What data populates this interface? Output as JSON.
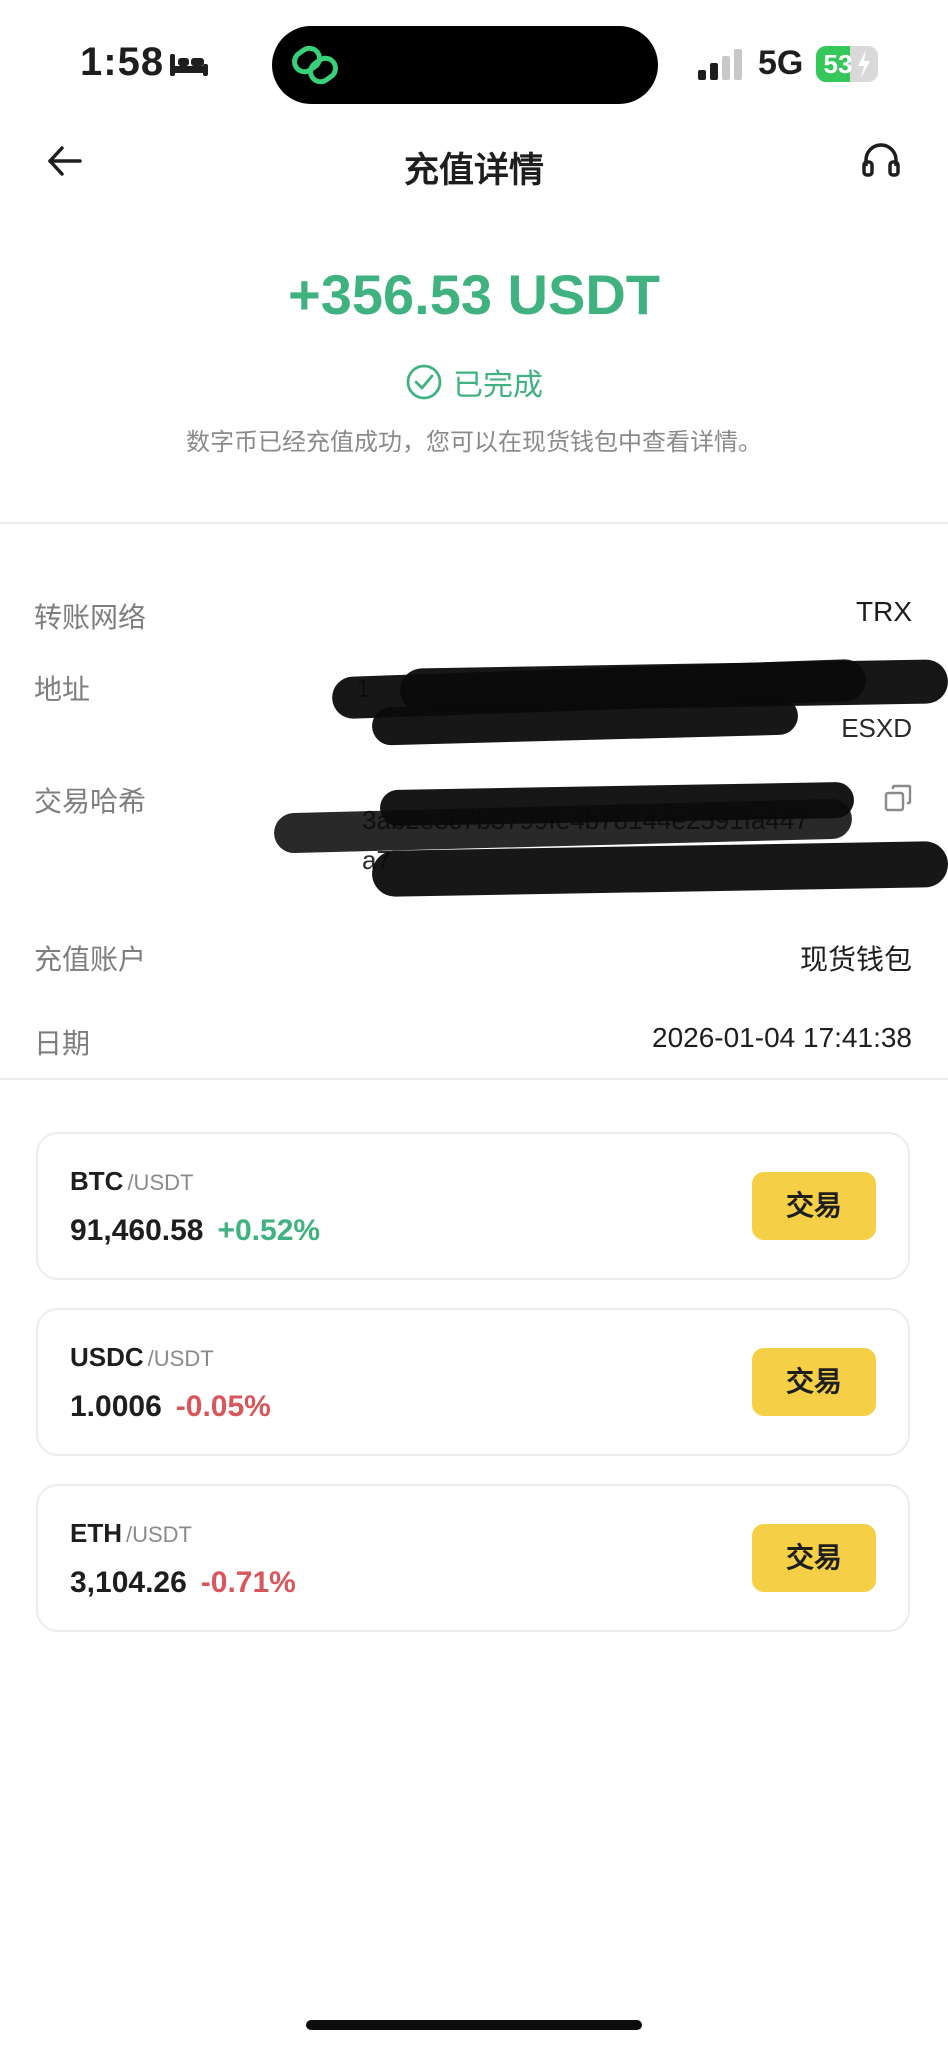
{
  "status_bar": {
    "time": "1:58",
    "network": "5G",
    "battery": "53"
  },
  "header": {
    "title": "充值详情"
  },
  "summary": {
    "amount": "+356.53 USDT",
    "status": "已完成",
    "description": "数字币已经充值成功，您可以在现货钱包中查看详情。"
  },
  "details": {
    "network_label": "转账网络",
    "network_value": "TRX",
    "address_label": "地址",
    "address_fragment_1": "1",
    "address_fragment_2": "ESXD",
    "tx_hash_label": "交易哈希",
    "tx_hash_line_1": "3ab2e3c7b3799fe4b78144e2591fa447",
    "tx_hash_line_2": "a7",
    "account_label": "充值账户",
    "account_value": "现货钱包",
    "date_label": "日期",
    "date_value": "2026-01-04 17:41:38"
  },
  "markets": [
    {
      "base": "BTC",
      "quote": "/USDT",
      "price": "91,460.58",
      "change": "+0.52%",
      "direction": "up",
      "trade_label": "交易"
    },
    {
      "base": "USDC",
      "quote": "/USDT",
      "price": "1.0006",
      "change": "-0.05%",
      "direction": "down",
      "trade_label": "交易"
    },
    {
      "base": "ETH",
      "quote": "/USDT",
      "price": "3,104.26",
      "change": "-0.71%",
      "direction": "down",
      "trade_label": "交易"
    }
  ],
  "colors": {
    "positive": "#3fb27f",
    "negative": "#d8575c",
    "trade_button": "#f5d046",
    "label_gray": "#7e7e7e"
  },
  "icons": {
    "back": "arrow-left-icon",
    "support": "headset-icon",
    "status": "check-circle-icon",
    "copy": "copy-icon"
  }
}
